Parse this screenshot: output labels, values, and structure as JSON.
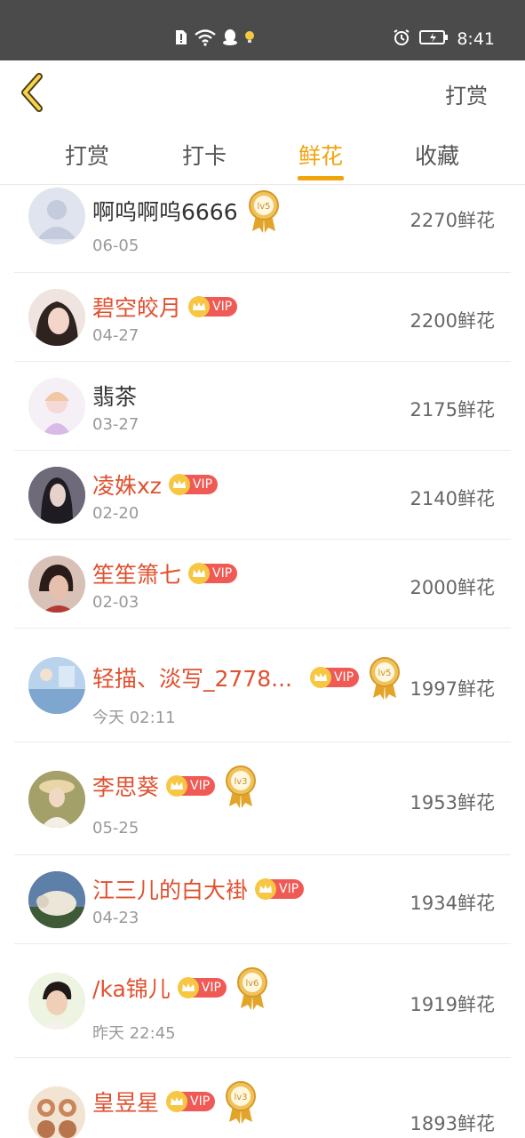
{
  "status_bar": {
    "time": "8:41",
    "icons": [
      "sim-alert-icon",
      "wifi-icon",
      "qq-icon",
      "bulb-icon",
      "alarm-icon",
      "battery-icon"
    ]
  },
  "topbar": {
    "action_label": "打赏"
  },
  "tabs": [
    {
      "label": "打赏",
      "active": false
    },
    {
      "label": "打卡",
      "active": false
    },
    {
      "label": "鲜花",
      "active": true
    },
    {
      "label": "收藏",
      "active": false
    }
  ],
  "colors": {
    "accent": "#f2a40e",
    "vip_name": "#e0512f",
    "vip_badge": "#ef5a55",
    "status_bar": "#4b4b4b"
  },
  "list": [
    {
      "name": "啊呜啊呜6666",
      "vip": false,
      "level": "lv5",
      "date": "06-05",
      "amount": "2270鲜花"
    },
    {
      "name": "碧空皎月",
      "vip": true,
      "level": "",
      "date": "04-27",
      "amount": "2200鲜花"
    },
    {
      "name": "翡茶",
      "vip": false,
      "level": "",
      "date": "03-27",
      "amount": "2175鲜花"
    },
    {
      "name": "凌姝xz",
      "vip": true,
      "level": "",
      "date": "02-20",
      "amount": "2140鲜花"
    },
    {
      "name": "笙笙箫七",
      "vip": true,
      "level": "",
      "date": "02-03",
      "amount": "2000鲜花"
    },
    {
      "name": "轻描、淡写_2778...",
      "vip": true,
      "level": "lv5",
      "date": "今天 02:11",
      "amount": "1997鲜花"
    },
    {
      "name": "李思葵",
      "vip": true,
      "level": "lv3",
      "date": "05-25",
      "amount": "1953鲜花"
    },
    {
      "name": "江三儿的白大褂",
      "vip": true,
      "level": "",
      "date": "04-23",
      "amount": "1934鲜花"
    },
    {
      "name": "/ka锦儿",
      "vip": true,
      "level": "lv6",
      "date": "昨天 22:45",
      "amount": "1919鲜花"
    },
    {
      "name": "皇昱星",
      "vip": true,
      "level": "lv3",
      "date": "",
      "amount": "1893鲜花"
    }
  ],
  "vip_label": "VIP"
}
